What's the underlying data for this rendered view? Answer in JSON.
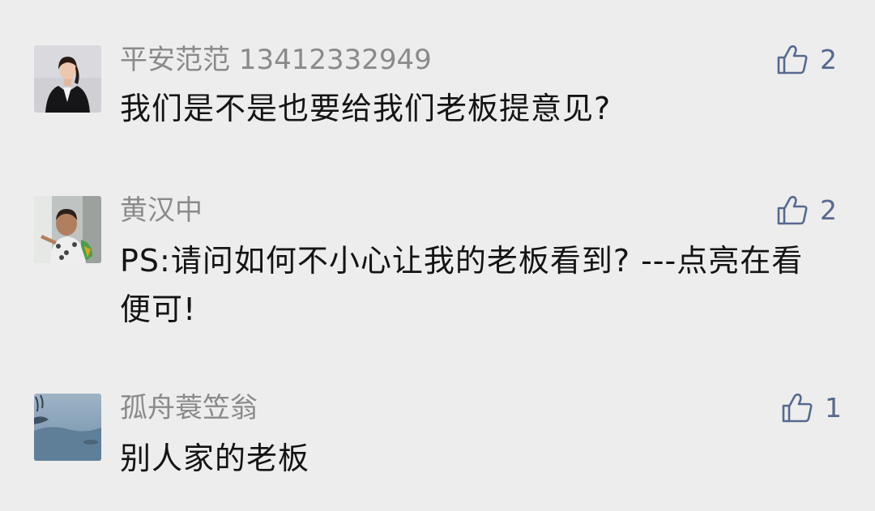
{
  "comments": [
    {
      "author": "平安范范 13412332949",
      "text": "我们是不是也要给我们老板提意见?",
      "likes": "2",
      "like_icon": "thumbs-up-icon",
      "avatar": "avatar-woman-in-suit"
    },
    {
      "author": "黄汉中",
      "text": "PS:请问如何不小心让我的老板看到? ---点亮在看便可!",
      "likes": "2",
      "like_icon": "thumbs-up-icon",
      "avatar": "avatar-child-photo"
    },
    {
      "author": "孤舟蓑笠翁",
      "text": "别人家的老板",
      "likes": "1",
      "like_icon": "thumbs-up-icon",
      "avatar": "avatar-misty-landscape"
    }
  ],
  "colors": {
    "background": "#ededed",
    "author": "#8a8a8a",
    "text": "#141414",
    "like": "#56698f"
  }
}
